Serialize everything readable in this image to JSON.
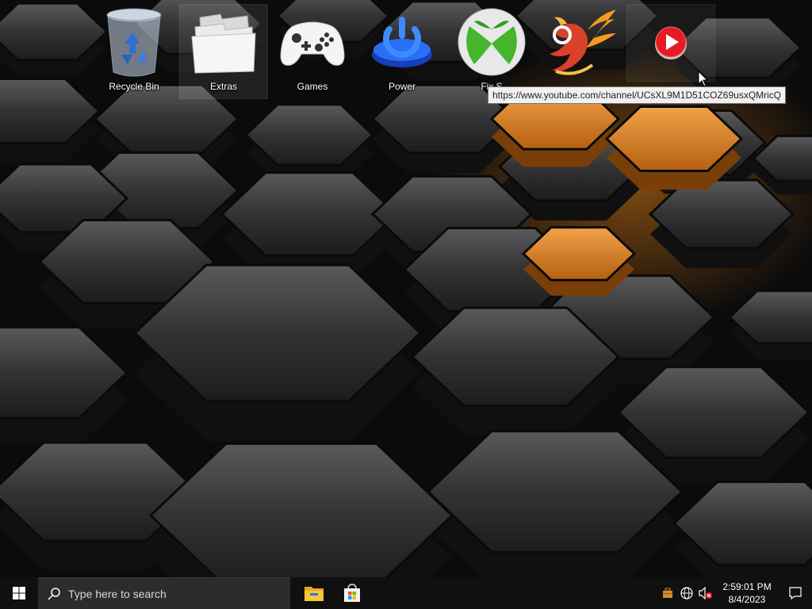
{
  "desktop": {
    "icons": [
      {
        "label": "Recycle Bin",
        "icon": "recycle-bin-icon"
      },
      {
        "label": "Extras",
        "icon": "folder-icon"
      },
      {
        "label": "Games",
        "icon": "game-controller-icon"
      },
      {
        "label": "Power",
        "icon": "power-icon"
      },
      {
        "label": "Fix S",
        "icon": "xbox-icon"
      },
      {
        "label": "",
        "icon": "phoenix-icon"
      },
      {
        "label": "",
        "icon": "youtube-play-icon"
      }
    ],
    "tooltip": "https://www.youtube.com/channel/UCsXL9M1D51COZ69usxQMricQ",
    "wallpaper": "black-orange-hexagons"
  },
  "taskbar": {
    "search_placeholder": "Type here to search",
    "pinned": [
      {
        "name": "File Explorer",
        "icon": "file-explorer-icon"
      },
      {
        "name": "Microsoft Store",
        "icon": "store-icon"
      }
    ],
    "tray": {
      "icons": [
        "briefcase-icon",
        "network-globe-icon",
        "volume-muted-icon"
      ],
      "time": "2:59:01 PM",
      "date": "8/4/2023"
    }
  },
  "colors": {
    "taskbar": "#101010",
    "search_box": "#2c2c2c",
    "accent_orange": "#e8891f",
    "windows_blue": "#0078d7"
  }
}
